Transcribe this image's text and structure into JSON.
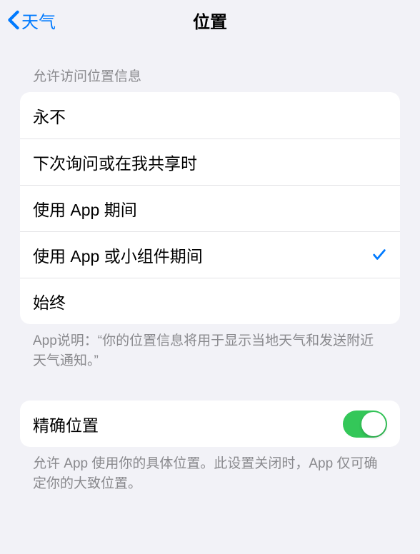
{
  "nav": {
    "back_label": "天气",
    "title": "位置"
  },
  "access": {
    "header": "允许访问位置信息",
    "options": [
      {
        "label": "永不",
        "selected": false
      },
      {
        "label": "下次询问或在我共享时",
        "selected": false
      },
      {
        "label": "使用 App 期间",
        "selected": false
      },
      {
        "label": "使用 App 或小组件期间",
        "selected": true
      },
      {
        "label": "始终",
        "selected": false
      }
    ],
    "footer": "App说明：“你的位置信息将用于显示当地天气和发送附近天气通知。”"
  },
  "precise": {
    "label": "精确位置",
    "enabled": true,
    "footer": "允许 App 使用你的具体位置。此设置关闭时，App 仅可确定你的大致位置。"
  }
}
